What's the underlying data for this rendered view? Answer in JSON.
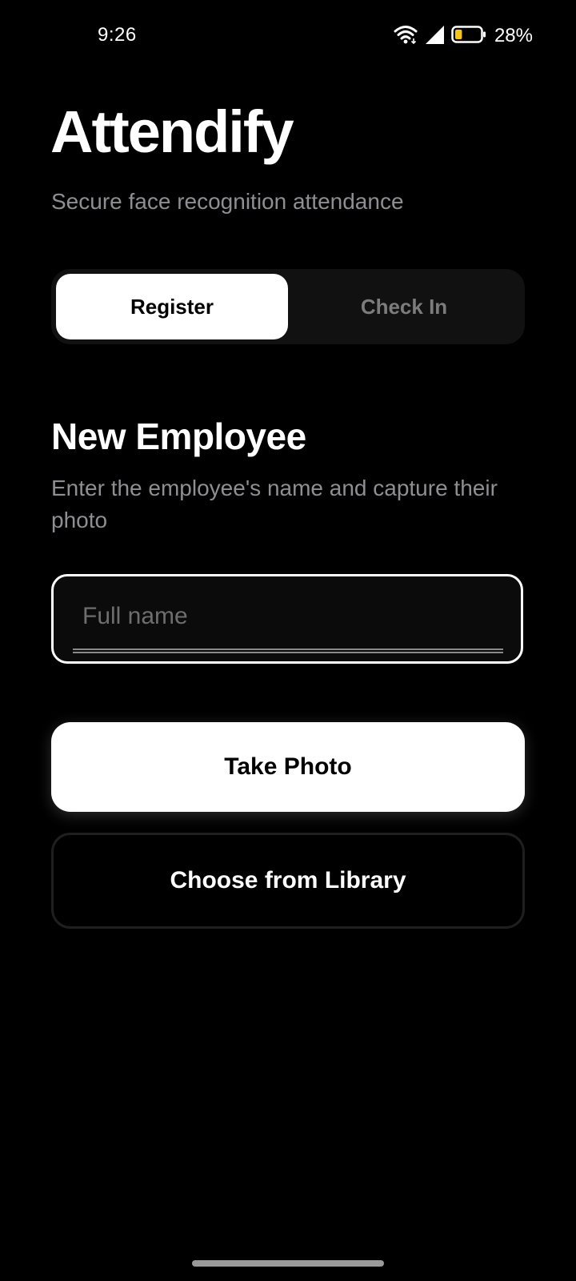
{
  "status_bar": {
    "time": "9:26",
    "battery_percent": "28%",
    "battery_level": 0.28,
    "icons": [
      "wifi-icon",
      "cellular-signal-icon",
      "battery-icon"
    ]
  },
  "header": {
    "app_title": "Attendify",
    "subtitle": "Secure face recognition attendance"
  },
  "mode_tabs": {
    "items": [
      {
        "label": "Register",
        "selected": true
      },
      {
        "label": "Check In",
        "selected": false
      }
    ]
  },
  "form": {
    "title": "New Employee",
    "description": "Enter the employee's name and capture their photo",
    "name_input": {
      "value": "",
      "placeholder": "Full name"
    },
    "take_photo_label": "Take Photo",
    "choose_library_label": "Choose from Library"
  },
  "colors": {
    "background": "#000000",
    "text_primary": "#ffffff",
    "text_secondary": "#8e8e93",
    "segment_background": "#111111",
    "battery_fill": "#f5c518"
  }
}
